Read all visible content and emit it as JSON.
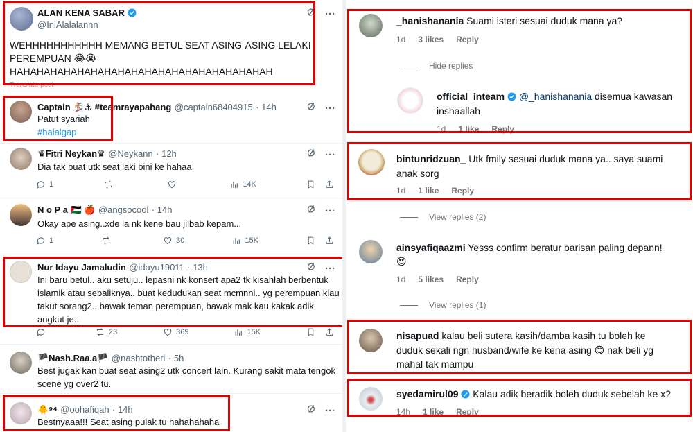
{
  "left": {
    "main_tweet": {
      "name": "ALAN KENA SABAR",
      "handle": "@IniAlalalannn",
      "text_line1": "WEHHHHHHHHHHH MEMANG BETUL SEAT ASING-ASING LELAKI",
      "text_line2": "PEREMPUAN 😂😭",
      "text_line3": "HAHAHAHAHAHAHAHAHAHAHAHAHAHAHAHAHAHAHAH",
      "translate": "Translate post"
    },
    "replies": [
      {
        "name": "Captain 🏂⚓ #teamrayapahang",
        "handle": "@captain68404915",
        "time": "· 14h",
        "line1": "Patut syariah",
        "line2": "#halalgap"
      },
      {
        "name": "♛Fitri Neykan♛",
        "handle": "@Neykann",
        "time": "· 12h",
        "line1": "Dia tak buat utk seat laki bini ke hahaa",
        "replies": "1",
        "retweets": "",
        "likes": "",
        "views": "14K"
      },
      {
        "name": "N o P a 🇵🇸 🍎",
        "handle": "@angsocool",
        "time": "· 14h",
        "line1": "Okay ape asing..xde la nk kene bau jilbab kepam...",
        "replies": "1",
        "retweets": "",
        "likes": "30",
        "views": "15K"
      },
      {
        "name": "Nur Idayu Jamaludin",
        "handle": "@idayu19011",
        "time": "· 13h",
        "line1": "Ini baru betul.. aku setuju.. lepasni nk konsert apa2 tk kisahlah berbentuk",
        "line2": "islamik atau sebaliknya.. buat kedudukan seat mcmnni.. yg perempuan klau",
        "line3": "takut sorang2.. bawak teman perempuan, bawak mak kau kakak adik",
        "line4": "angkut je..",
        "replies": "",
        "retweets": "23",
        "likes": "369",
        "views": "15K"
      },
      {
        "name": "🏴Nash.Raa.a🏴",
        "handle": "@nashtotheri",
        "time": "· 5h",
        "line1": "Best jugak kan buat seat asing2 utk concert lain. Kurang sakit mata tengok",
        "line2": "scene yg over2 tu."
      },
      {
        "name": "🐥⁹⁴",
        "handle": "@oohafiqah",
        "time": "· 14h",
        "line1": "Bestnyaaa!!! Seat asing pulak tu hahahahaha"
      }
    ]
  },
  "right": {
    "comments": [
      {
        "user": "_hanishanania",
        "text": "Suami isteri sesuai duduk mana ya?",
        "age": "1d",
        "likes": "3 likes",
        "reply": "Reply",
        "hide": "Hide replies"
      },
      {
        "user": "official_inteam",
        "mention": "@_hanishanania",
        "text1": "disemua kawasan",
        "text2": "inshaallah",
        "age": "1d",
        "likes": "1 like",
        "reply": "Reply"
      },
      {
        "user": "bintunridzuan_",
        "text1": "Utk fmily sesuai duduk mana ya.. saya suami",
        "text2": "anak sorg",
        "age": "1d",
        "likes": "1 like",
        "reply": "Reply",
        "view": "View replies (2)"
      },
      {
        "user": "ainsyafiqaazmi",
        "text1": "Yesss confirm beratur barisan paling depann!",
        "text2": "😍",
        "age": "1d",
        "likes": "5 likes",
        "reply": "Reply",
        "view": "View replies (1)"
      },
      {
        "user": "nisapuad",
        "text1": "kalau beli sutera kasih/damba kasih tu boleh ke",
        "text2": "duduk sekali ngn husband/wife ke kena asing 😋 nak beli yg",
        "text3": "mahal tak mampu"
      },
      {
        "user": "syedamirul09",
        "text": "Kalau adik beradik boleh duduk sebelah ke x?",
        "age": "14h",
        "likes": "1 like",
        "reply": "Reply"
      }
    ]
  },
  "colors": {
    "highlight": "#e00000",
    "link": "#1d9bf0",
    "verified": "#1d9bf0",
    "muted": "#536471"
  }
}
